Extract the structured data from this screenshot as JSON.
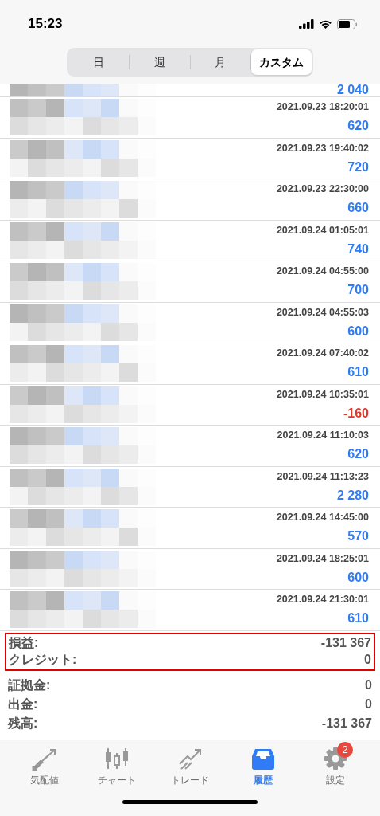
{
  "status_bar": {
    "time": "15:23"
  },
  "period_tabs": [
    {
      "label": "日",
      "selected": false
    },
    {
      "label": "週",
      "selected": false
    },
    {
      "label": "月",
      "selected": false
    },
    {
      "label": "カスタム",
      "selected": true
    }
  ],
  "history": [
    {
      "amount": "2 040",
      "kind": "gain",
      "partial": true
    },
    {
      "time": "2021.09.23 18:20:01",
      "amount": "620",
      "kind": "gain"
    },
    {
      "time": "2021.09.23 19:40:02",
      "amount": "720",
      "kind": "gain"
    },
    {
      "time": "2021.09.23 22:30:00",
      "amount": "660",
      "kind": "gain"
    },
    {
      "time": "2021.09.24 01:05:01",
      "amount": "740",
      "kind": "gain"
    },
    {
      "time": "2021.09.24 04:55:00",
      "amount": "700",
      "kind": "gain"
    },
    {
      "time": "2021.09.24 04:55:03",
      "amount": "600",
      "kind": "gain"
    },
    {
      "time": "2021.09.24 07:40:02",
      "amount": "610",
      "kind": "gain"
    },
    {
      "time": "2021.09.24 10:35:01",
      "amount": "-160",
      "kind": "loss"
    },
    {
      "time": "2021.09.24 11:10:03",
      "amount": "620",
      "kind": "gain"
    },
    {
      "time": "2021.09.24 11:13:23",
      "amount": "2 280",
      "kind": "gain"
    },
    {
      "time": "2021.09.24 14:45:00",
      "amount": "570",
      "kind": "gain"
    },
    {
      "time": "2021.09.24 18:25:01",
      "amount": "600",
      "kind": "gain"
    },
    {
      "time": "2021.09.24 21:30:01",
      "amount": "610",
      "kind": "gain"
    }
  ],
  "summary": [
    {
      "label": "損益:",
      "value": "-131 367",
      "highlighted": true
    },
    {
      "label": "クレジット:",
      "value": "0",
      "highlighted": true
    },
    {
      "label": "証拠金:",
      "value": "0",
      "highlighted": false
    },
    {
      "label": "出金:",
      "value": "0",
      "highlighted": false
    },
    {
      "label": "残高:",
      "value": "-131 367",
      "highlighted": false
    }
  ],
  "bottom_tabs": [
    {
      "label": "気配値",
      "kind": "quotes",
      "selected": false
    },
    {
      "label": "チャート",
      "kind": "chart",
      "selected": false
    },
    {
      "label": "トレード",
      "kind": "trade",
      "selected": false
    },
    {
      "label": "履歴",
      "kind": "history",
      "selected": true
    },
    {
      "label": "設定",
      "kind": "settings",
      "selected": false,
      "badge": "2"
    }
  ]
}
